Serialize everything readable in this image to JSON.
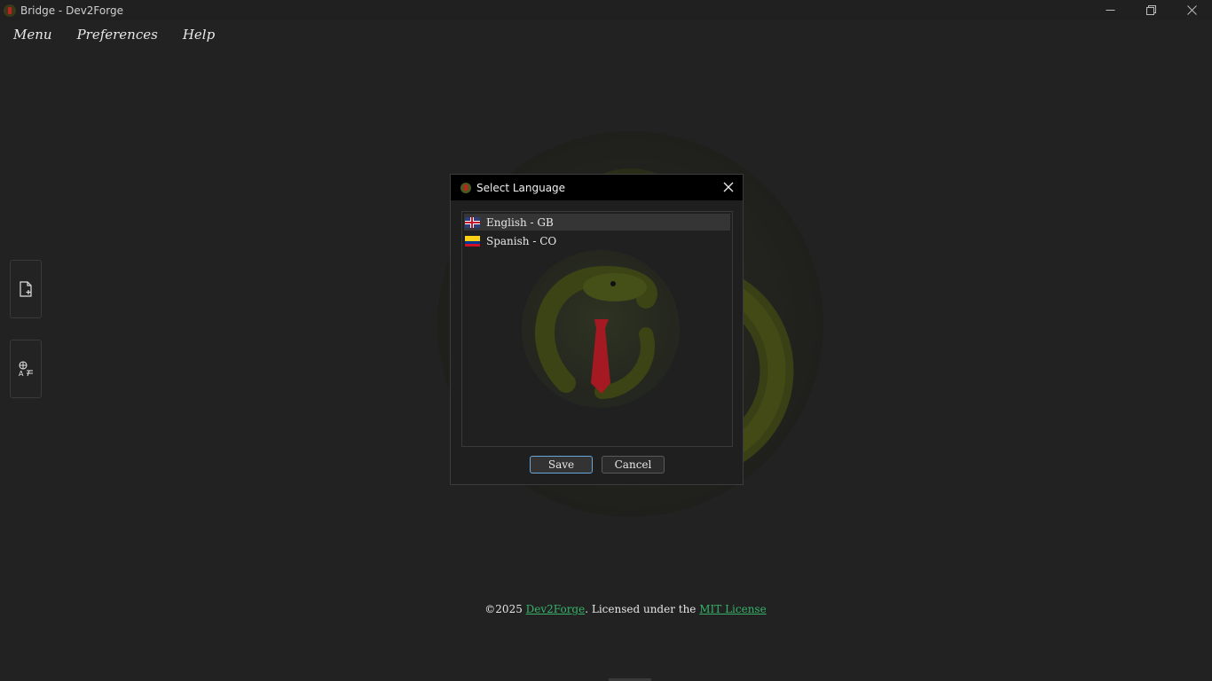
{
  "window": {
    "title": "Bridge - Dev2Forge",
    "icon": "app-logo-icon",
    "controls": [
      "minimize-icon",
      "restore-icon",
      "close-icon"
    ]
  },
  "menubar": {
    "items": [
      "Menu",
      "Preferences",
      "Help"
    ]
  },
  "sidebar": {
    "buttons": [
      "new-file-icon",
      "translate-icon"
    ]
  },
  "dialog": {
    "title": "Select Language",
    "languages": [
      {
        "label": "English - GB",
        "flag": "uk-flag-icon",
        "selected": true
      },
      {
        "label": "Spanish - CO",
        "flag": "colombia-flag-icon",
        "selected": false
      }
    ],
    "save_label": "Save",
    "cancel_label": "Cancel"
  },
  "footer": {
    "prefix": "©2025 ",
    "org_link": "Dev2Forge",
    "middle": ". Licensed under the ",
    "license_link": "MIT License"
  },
  "colors": {
    "background": "#222222",
    "link": "#36b26a",
    "save_border": "#6aa6d8"
  }
}
